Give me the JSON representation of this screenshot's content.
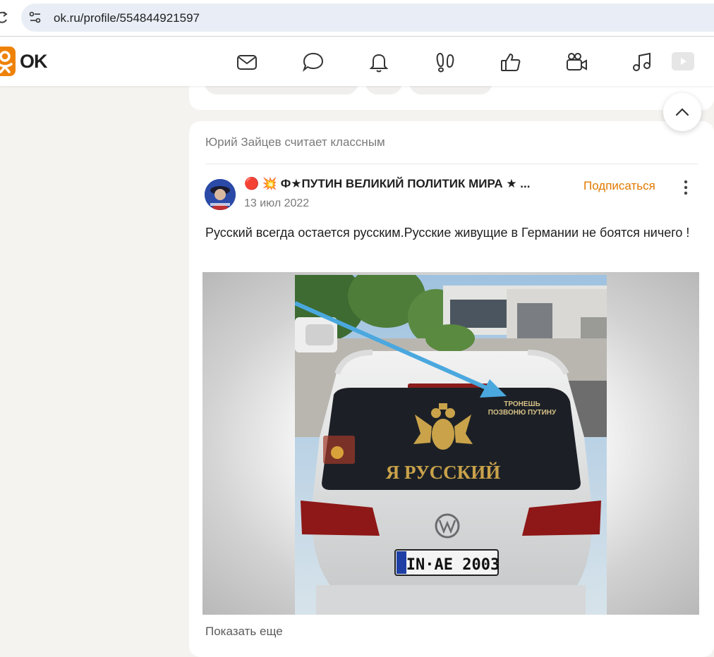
{
  "browser": {
    "url": "ok.ru/profile/554844921597"
  },
  "header": {
    "logo_text": "OK",
    "nav_icons": [
      "mail-icon",
      "chat-icon",
      "bell-icon",
      "guests-icon",
      "like-icon",
      "video-icon",
      "music-icon",
      "games-icon"
    ]
  },
  "post": {
    "activity": "Юрий Зайцев считает классным",
    "group_name": "🔴 💥 Ф★ПУТИН ВЕЛИКИЙ ПОЛИТИК МИРА ★ ...",
    "date": "13 июл 2022",
    "subscribe_label": "Подписаться",
    "text": "Русский всегда остается русским.Русские живущие в Германии не боятся ничего !",
    "photo": {
      "window_top_text_1": "ТРОНЕШЬ",
      "window_top_text_2": "ПОЗВОНЮ ПУТИНУ",
      "window_main_text": "Я РУССКИЙ",
      "plate_text": "IN·AE 2003"
    },
    "show_more_label": "Показать еще"
  },
  "colors": {
    "accent": "#ee8208",
    "subscribe": "#e07a00"
  }
}
